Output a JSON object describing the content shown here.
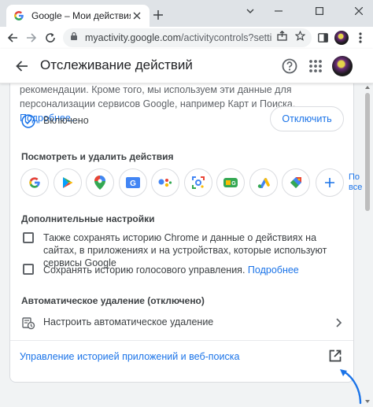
{
  "browser": {
    "tab_title": "Google – Мои действия",
    "url_domain": "myactivity.google.com",
    "url_path": "/activitycontrols?settings=s…",
    "icons": [
      "google-favicon",
      "close-icon",
      "plus-icon",
      "chevron-down-icon",
      "minimize-icon",
      "maximize-icon",
      "close-window-icon",
      "back-icon",
      "forward-icon",
      "reload-icon",
      "site-info-icon",
      "share-icon",
      "star-icon",
      "sidepanel-icon",
      "avatar",
      "kebab-menu-icon"
    ]
  },
  "header": {
    "title": "Отслеживание действий",
    "icons": [
      "arrow-back-icon",
      "help-icon",
      "apps-grid-icon",
      "account-avatar"
    ]
  },
  "main": {
    "description": "рекомендации. Кроме того, мы используем эти данные для персонализации сервисов Google, например Карт и Поиска.",
    "more_link": "Подробнее…",
    "status_label": "Включено",
    "disable_button": "Отключить",
    "view_section_title": "Посмотреть и удалить действия",
    "products": [
      "google-search-icon",
      "google-play-icon",
      "google-maps-icon",
      "google-news-icon",
      "google-assistant-icon",
      "google-lens-icon",
      "google-play-games-icon",
      "google-ads-icon",
      "google-shopping-icon"
    ],
    "more_products_label_line1": "По",
    "more_products_label_line2": "все",
    "advanced_section_title": "Дополнительные настройки",
    "option_chrome": "Также сохранять историю Chrome и данные о действиях на сайтах, в приложениях и на устройствах, которые используют сервисы Google",
    "option_voice": "Сохранять историю голосового управления.",
    "option_voice_link": "Подробнее",
    "autodelete_section_title": "Автоматическое удаление (отключено)",
    "autodelete_action": "Настроить автоматическое удаление",
    "manage_history_link": "Управление историей приложений и веб-поиска"
  },
  "colors": {
    "accent_blue": "#1a73e8",
    "text_primary": "#202124",
    "text_secondary": "#5f6368",
    "tabstrip_bg": "#dfe3e7",
    "page_bg": "#f1f3f4"
  }
}
